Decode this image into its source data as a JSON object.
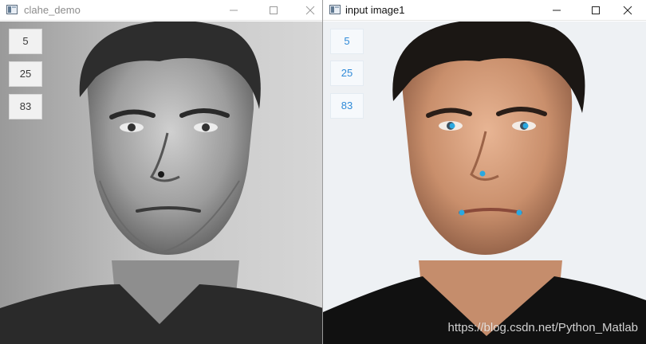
{
  "windows": {
    "left": {
      "title": "clahe_demo",
      "buttons": [
        "5",
        "25",
        "83"
      ]
    },
    "right": {
      "title": "input image1",
      "buttons": [
        "5",
        "25",
        "83"
      ]
    }
  },
  "watermark": "https://blog.csdn.net/Python_Matlab",
  "icons": {
    "minimize": "minimize-icon",
    "maximize": "maximize-icon",
    "close": "close-icon",
    "app": "opencv-window-icon"
  },
  "colors": {
    "landmark": "#2aa8e0",
    "right_button_text": "#2f8ad8",
    "left_title_text": "#8c8c8c"
  },
  "landmarks": [
    {
      "name": "left-eye"
    },
    {
      "name": "right-eye"
    },
    {
      "name": "nose-tip"
    },
    {
      "name": "mouth-left"
    },
    {
      "name": "mouth-right"
    }
  ]
}
